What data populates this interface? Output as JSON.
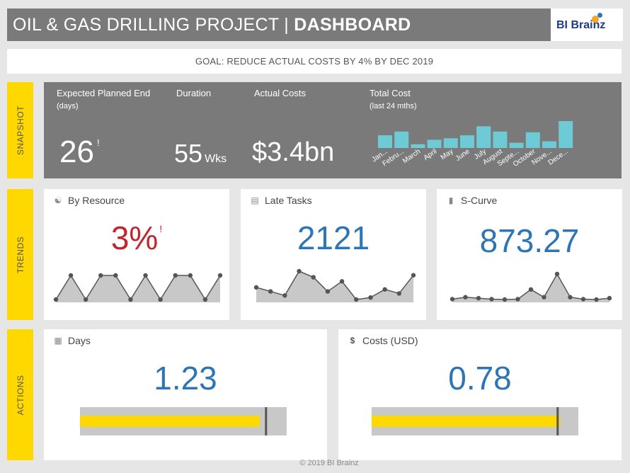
{
  "header": {
    "title_prefix": "OIL & GAS DRILLING PROJECT | ",
    "title_bold": "DASHBOARD"
  },
  "logo": {
    "text": "BI Brainz"
  },
  "goal": "GOAL: REDUCE ACTUAL COSTS BY 4% BY DEC 2019",
  "sections": {
    "snapshot": "SNAPSHOT",
    "trends": "TRENDS",
    "actions": "ACTIONS"
  },
  "snapshot": {
    "expected": {
      "label": "Expected Planned End",
      "sub": "(days)",
      "value": "26",
      "alert": "!"
    },
    "duration": {
      "label": "Duration",
      "value": "55",
      "unit": "Wks"
    },
    "actual": {
      "label": "Actual Costs",
      "value": "$3.4bn"
    },
    "total": {
      "label": "Total Cost",
      "sub": "(last 24 mths)"
    }
  },
  "cards": {
    "resource": {
      "title": "By Resource",
      "value": "3%",
      "alert": "!",
      "icon": "people-icon"
    },
    "late": {
      "title": "Late Tasks",
      "value": "2121",
      "icon": "clipboard-icon"
    },
    "scurve": {
      "title": "S-Curve",
      "value": "873.27",
      "icon": "bar-chart-icon"
    },
    "days": {
      "title": "Days",
      "value": "1.23",
      "icon": "calendar-icon",
      "fill": 0.87,
      "target": 0.9
    },
    "costs": {
      "title": "Costs (USD)",
      "value": "0.78",
      "icon": "dollar-icon",
      "fill": 0.91,
      "target": 0.9
    }
  },
  "colors": {
    "accent": "#2e75b6",
    "alert": "#c0272d",
    "bullet": "#ffd800",
    "bar": "#6ecbd6",
    "section": "#ffd800"
  },
  "chart_data": [
    {
      "type": "bar",
      "title": "Total Cost",
      "categories": [
        "January",
        "February",
        "March",
        "April",
        "May",
        "June",
        "July",
        "August",
        "September",
        "October",
        "November",
        "December"
      ],
      "tick_labels": [
        "Jan...",
        "Febru...",
        "March",
        "April",
        "May",
        "June",
        "July",
        "August",
        "Septe...",
        "October",
        "Nove...",
        "Dece..."
      ],
      "values": [
        17,
        22,
        5,
        11,
        13,
        17,
        29,
        22,
        7,
        21,
        9,
        36
      ]
    },
    {
      "type": "area",
      "title": "By Resource",
      "values": [
        0,
        10,
        0,
        10,
        10,
        0,
        10,
        0,
        10,
        10,
        0,
        10
      ]
    },
    {
      "type": "area",
      "title": "Late Tasks",
      "values": [
        7,
        5,
        3,
        15,
        12,
        5,
        10,
        1,
        2,
        6,
        4,
        13
      ]
    },
    {
      "type": "area",
      "title": "S-Curve",
      "values": [
        1,
        2,
        1.5,
        1,
        0.8,
        1,
        6,
        2,
        14,
        2,
        1,
        0.8,
        1.5
      ]
    }
  ]
}
